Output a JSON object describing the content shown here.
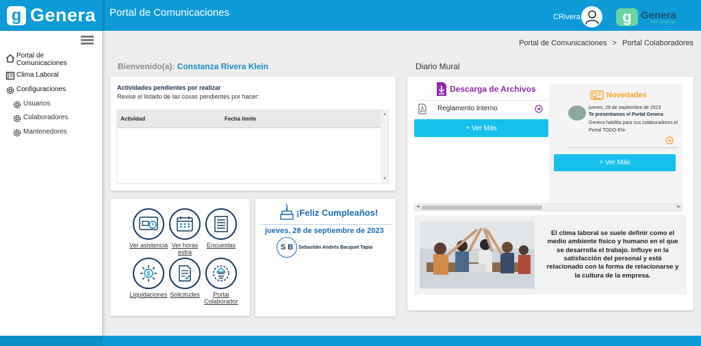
{
  "header": {
    "brand": "Genera",
    "title": "Portal de Comunicaciones",
    "user": "CRivera",
    "hr_logo_name": "Genera",
    "hr_logo_sub": "HR Digital"
  },
  "sidebar": {
    "items": [
      {
        "label": "Portal de Comunicaciones",
        "icon": "home-icon"
      },
      {
        "label": "Clima Laboral",
        "icon": "document-icon"
      },
      {
        "label": "Configuraciones",
        "icon": "gear-icon"
      },
      {
        "label": "Usuarios",
        "icon": "gear-icon"
      },
      {
        "label": "Colaboradores",
        "icon": "gear-icon"
      },
      {
        "label": "Mantenedores",
        "icon": "gear-icon"
      }
    ]
  },
  "breadcrumb": {
    "first": "Portal de Comunicaciones",
    "separator": ">",
    "second": "Portal Colaboradores"
  },
  "welcome": {
    "prefix": "Bienvenido(a):",
    "name": "Constanza Rivera Klein"
  },
  "activities": {
    "title": "Actividades pendientes por realizar",
    "subtitle": "Revise el listado de las cosas pendientes por hacer:",
    "columns": [
      "Actividad",
      "Fecha límite"
    ]
  },
  "tiles": [
    {
      "label": "Ver asistencia",
      "icon": "attendance-icon"
    },
    {
      "label": "Ver horas extra",
      "icon": "calendar-icon"
    },
    {
      "label": "Encuestas",
      "icon": "survey-icon"
    },
    {
      "label": "Liquidaciones",
      "icon": "payroll-icon"
    },
    {
      "label": "Solicitudes",
      "icon": "request-icon"
    },
    {
      "label": "Portal Colaborador",
      "icon": "portal-icon"
    }
  ],
  "birthday": {
    "title": "¡Feliz Cumpleaños!",
    "date": "jueves, 28 de septiembre de 2023",
    "initials": "S B",
    "name": "Sebastián Andrés Bacquet Tapia"
  },
  "mural": {
    "title": "Diario Mural",
    "downloads": {
      "title": "Descarga de Archivos",
      "items": [
        "Reglamento Interno"
      ],
      "button": "+ Ver Más"
    },
    "news": {
      "title": "Novedades",
      "date": "jueves, 28 de septiembre de 2023",
      "headline": "Te presentamos el Portal Genera",
      "text": "Genera habilita para sus colaboradores el Portal TODO-EN-",
      "button": "+ Ver Más"
    },
    "clima_text": "El clima laboral se suele definir como el medio ambiente físico y humano en el que se desarrolla el trabajo. Influye en la satisfacción del personal y está relacionado con la forma de relacionarse y la cultura de la empresa."
  },
  "colors": {
    "primary": "#0d9bd8",
    "button": "#17c0ea",
    "accent_purple": "#8b2aa8",
    "accent_orange": "#f0a32a",
    "name_blue": "#1b8bc4"
  }
}
